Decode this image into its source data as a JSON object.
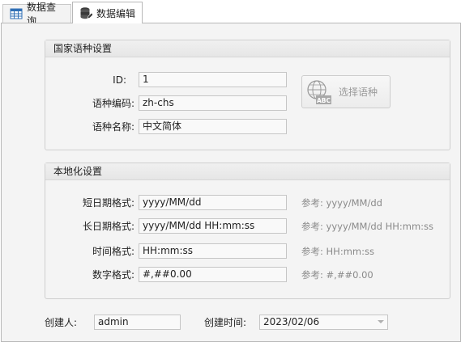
{
  "tabs": [
    {
      "label": "数据查询",
      "icon": "table-grid-icon",
      "active": false
    },
    {
      "label": "数据编辑",
      "icon": "database-icon",
      "active": true
    }
  ],
  "lang_group": {
    "title": "国家语种设置",
    "id_label": "ID:",
    "id_value": "1",
    "code_label": "语种编码:",
    "code_value": "zh-chs",
    "name_label": "语种名称:",
    "name_value": "中文简体",
    "select_button": "选择语种",
    "select_icon": "globe-abc-icon"
  },
  "locale_group": {
    "title": "本地化设置",
    "rows": [
      {
        "label": "短日期格式:",
        "value": "yyyy/MM/dd",
        "ref": "参考: yyyy/MM/dd"
      },
      {
        "label": "长日期格式:",
        "value": "yyyy/MM/dd HH:mm:ss",
        "ref": "参考: yyyy/MM/dd HH:mm:ss"
      },
      {
        "label": "时间格式:",
        "value": "HH:mm:ss",
        "ref": "参考: HH:mm:ss"
      },
      {
        "label": "数字格式:",
        "value": "#,##0.00",
        "ref": "参考: #,##0.00"
      }
    ]
  },
  "footer": {
    "creator_label": "创建人:",
    "creator_value": "admin",
    "created_time_label": "创建时间:",
    "created_time_value": "2023/02/06"
  }
}
